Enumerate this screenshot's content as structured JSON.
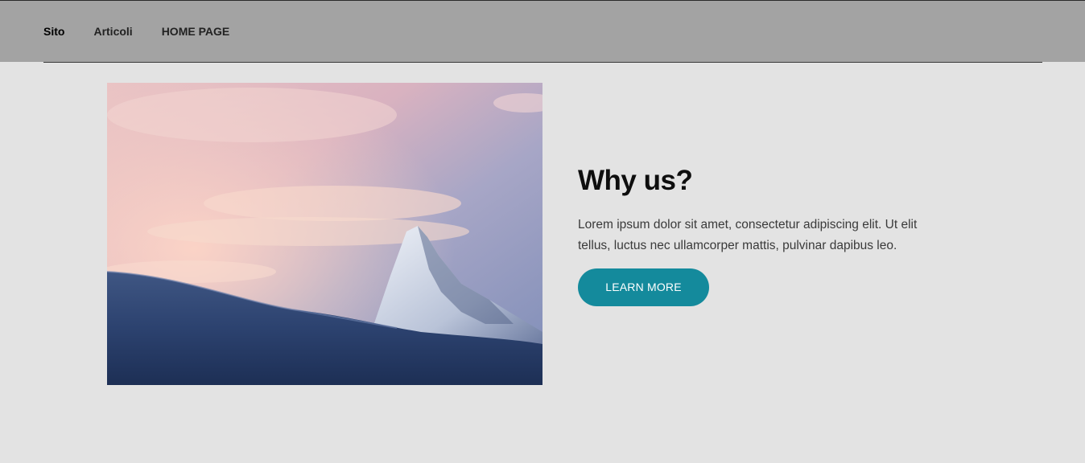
{
  "nav": {
    "items": [
      {
        "label": "Sito",
        "active": true
      },
      {
        "label": "Articoli",
        "active": false
      },
      {
        "label": "HOME PAGE",
        "active": false
      }
    ]
  },
  "hero": {
    "image_subject": "snowy-mountain-peak-at-sunset",
    "title": "Why us?",
    "body": "Lorem ipsum dolor sit amet, consectetur adipiscing elit. Ut elit tellus, luctus nec ullamcorper mattis, pulvinar dapibus leo.",
    "button_label": "LEARN MORE"
  },
  "colors": {
    "header_bg": "#a3a3a3",
    "page_bg": "#e3e3e3",
    "accent": "#148a9c"
  }
}
